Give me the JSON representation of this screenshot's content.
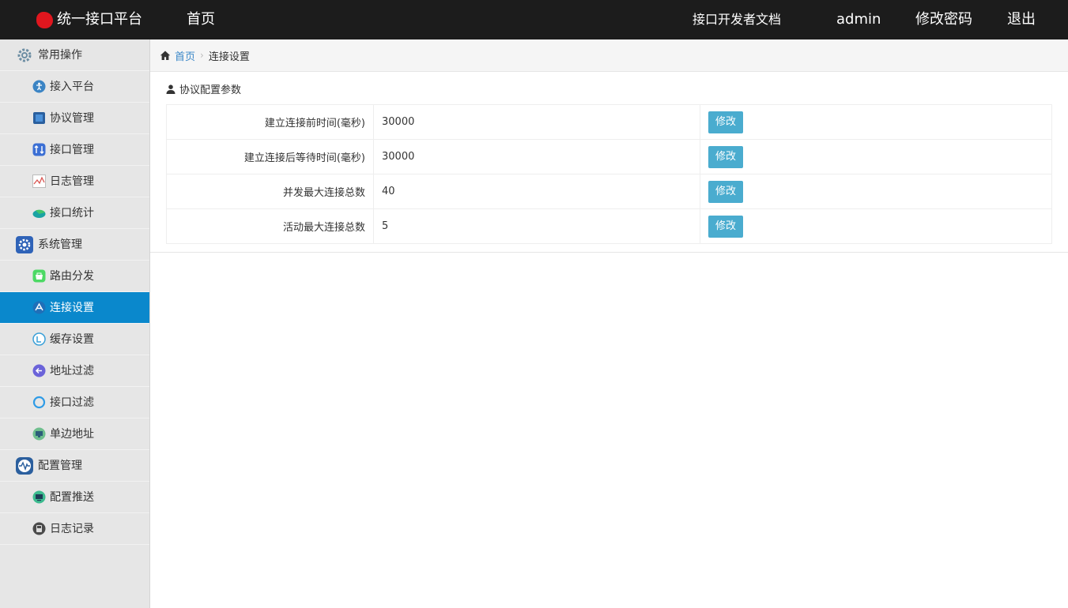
{
  "header": {
    "brand": "统一接口平台",
    "home": "首页",
    "docs": "接口开发者文档",
    "user": "admin",
    "change_password": "修改密码",
    "logout": "退出"
  },
  "sidebar": {
    "groups": [
      {
        "label": "常用操作",
        "icon": "gear-icon",
        "items": [
          {
            "label": "接入平台",
            "icon": "accessibility-icon"
          },
          {
            "label": "协议管理",
            "icon": "document-icon"
          },
          {
            "label": "接口管理",
            "icon": "swap-arrows-icon"
          },
          {
            "label": "日志管理",
            "icon": "line-chart-icon"
          },
          {
            "label": "接口统计",
            "icon": "pie-chart-icon"
          }
        ]
      },
      {
        "label": "系统管理",
        "icon": "settings-gear-icon",
        "items": [
          {
            "label": "路由分发",
            "icon": "basket-icon"
          },
          {
            "label": "连接设置",
            "icon": "tools-icon",
            "active": true
          },
          {
            "label": "缓存设置",
            "icon": "cache-icon"
          },
          {
            "label": "地址过滤",
            "icon": "arrow-left-circle-icon"
          },
          {
            "label": "接口过滤",
            "icon": "ring-icon"
          },
          {
            "label": "单边地址",
            "icon": "monitor-icon"
          }
        ]
      },
      {
        "label": "配置管理",
        "icon": "pulse-icon",
        "items": [
          {
            "label": "配置推送",
            "icon": "screen-icon"
          },
          {
            "label": "日志记录",
            "icon": "disk-icon"
          }
        ]
      }
    ]
  },
  "breadcrumb": {
    "home": "首页",
    "current": "连接设置"
  },
  "panel": {
    "title": "协议配置参数",
    "edit_label": "修改",
    "rows": [
      {
        "key": "建立连接前时间(毫秒)",
        "value": "30000"
      },
      {
        "key": "建立连接后等待时间(毫秒)",
        "value": "30000"
      },
      {
        "key": "并发最大连接总数",
        "value": "40"
      },
      {
        "key": "活动最大连接总数",
        "value": "5"
      }
    ]
  },
  "colors": {
    "topbar": "#1c1c1c",
    "sidebar": "#e6e6e6",
    "active": "#0a88cc",
    "button": "#4aaccf",
    "link": "#3a87c8",
    "brand_logo": "#e0161e"
  }
}
